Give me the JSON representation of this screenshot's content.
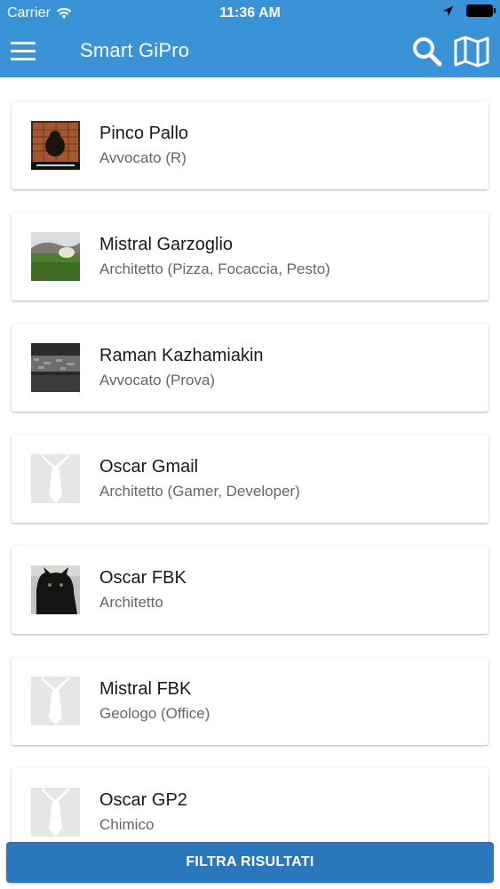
{
  "status_bar": {
    "carrier": "Carrier",
    "time": "11:36 AM",
    "icons": [
      "wifi-icon",
      "location-arrow-icon",
      "battery-icon"
    ]
  },
  "app_bar": {
    "title": "Smart GiPro",
    "icons": [
      "hamburger-menu-icon",
      "search-icon",
      "map-icon"
    ],
    "background_color": "#3a93d6"
  },
  "professionals": [
    {
      "name": "Pinco Pallo",
      "role": "Avvocato (R)",
      "avatar": "photo-cat-poster"
    },
    {
      "name": "Mistral Garzoglio",
      "role": "Architetto (Pizza, Focaccia, Pesto)",
      "avatar": "photo-field-landscape"
    },
    {
      "name": "Raman Kazhamiakin",
      "role": "Avvocato (Prova)",
      "avatar": "photo-dark-stone"
    },
    {
      "name": "Oscar Gmail",
      "role": "Architetto (Gamer, Developer)",
      "avatar": "placeholder-tie"
    },
    {
      "name": "Oscar FBK",
      "role": "Architetto",
      "avatar": "photo-black-cat"
    },
    {
      "name": "Mistral FBK",
      "role": "Geologo (Office)",
      "avatar": "placeholder-tie"
    },
    {
      "name": "Oscar GP2",
      "role": "Chimico",
      "avatar": "placeholder-tie"
    }
  ],
  "filter_button": {
    "label": "FILTRA RISULTATI",
    "background_color": "#2a77bd"
  }
}
